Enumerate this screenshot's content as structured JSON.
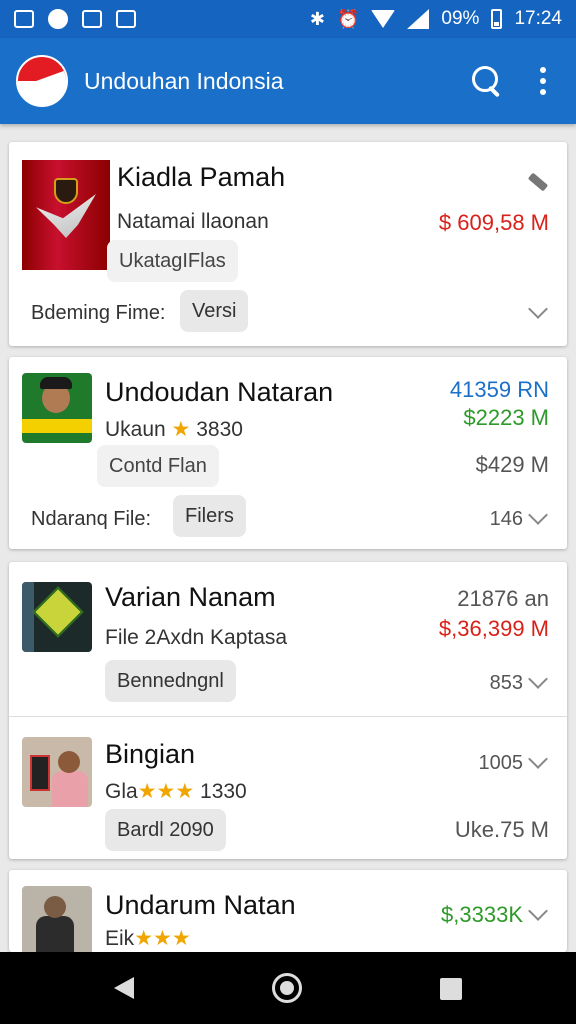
{
  "status": {
    "battery": "09%",
    "time": "17:24"
  },
  "app": {
    "title": "Undouhan Indonsia"
  },
  "cards": [
    {
      "title": "Kiadla Pamah",
      "subtitle": "Natamai llaonan",
      "subtitle2": "UkatagIFlas",
      "price": "$ 609,58 M",
      "footer_label": "Bdeming Fime:",
      "chip": "Versi"
    },
    {
      "title": "Undoudan Nataran",
      "rating_label": "Ukaun",
      "rating_stars": "★",
      "rating_value": "3830",
      "chip_top": "Contd Flan",
      "price_top": "41359 RN",
      "price_mid": "$2223 M",
      "price_bottom": "$429 M",
      "footer_label": "Ndaranq File:",
      "chip": "Filers",
      "count": "146"
    },
    {
      "title": "Varian Nanam",
      "subtitle": "File 2Axdn Kaptasa",
      "chip": "Bennedngnl",
      "meta_top": "21876 an",
      "price": "$,36,399 M",
      "count": "853"
    },
    {
      "title": "Bingian",
      "rating_label": "Gla",
      "rating_stars": "★★★",
      "rating_value": "1330",
      "chip": "Bardl 2090",
      "count": "1005",
      "size": "Uke.75 M"
    },
    {
      "title": "Undarum Natan",
      "rating_label": "Eik",
      "rating_stars": "★★★",
      "price": "$,3333K"
    }
  ]
}
